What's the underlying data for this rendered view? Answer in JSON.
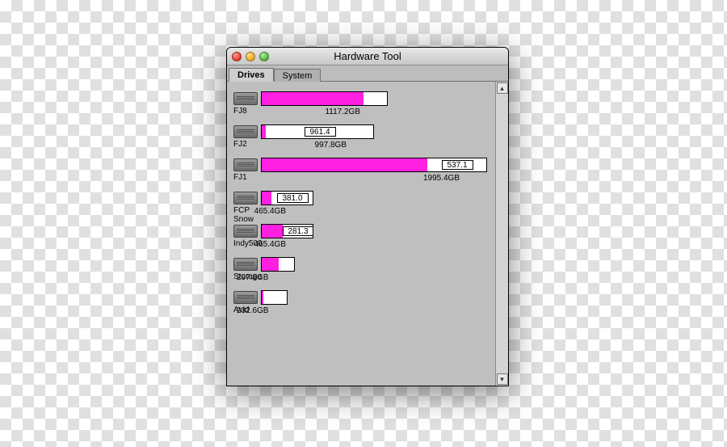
{
  "window": {
    "title": "Hardware Tool",
    "tabs": [
      {
        "label": "Drives",
        "active": true
      },
      {
        "label": "System",
        "active": false
      }
    ]
  },
  "max_capacity_gb": 1995.4,
  "drives": [
    {
      "name": "FJ8",
      "capacity_label": "1117.2GB",
      "capacity_gb": 1117.2,
      "used_gb": 900,
      "free_label": null
    },
    {
      "name": "FJ2",
      "capacity_label": "997.8GB",
      "capacity_gb": 997.8,
      "used_gb": 36,
      "free_label": "961.4"
    },
    {
      "name": "FJ1",
      "capacity_label": "1995.4GB",
      "capacity_gb": 1995.4,
      "used_gb": 1458,
      "free_label": "537.1"
    },
    {
      "name": "FCP Snow",
      "capacity_label": "465.4GB",
      "capacity_gb": 465.4,
      "used_gb": 84,
      "free_label": "381.0"
    },
    {
      "name": "Indy500",
      "capacity_label": "465.4GB",
      "capacity_gb": 465.4,
      "used_gb": 184,
      "free_label": "281.3"
    },
    {
      "name": "Storage",
      "capacity_label": "297.8GB",
      "capacity_gb": 297.8,
      "used_gb": 150,
      "free_label": null
    },
    {
      "name": "Avid",
      "capacity_label": "232.6GB",
      "capacity_gb": 232.6,
      "used_gb": 15,
      "free_label": null
    }
  ]
}
